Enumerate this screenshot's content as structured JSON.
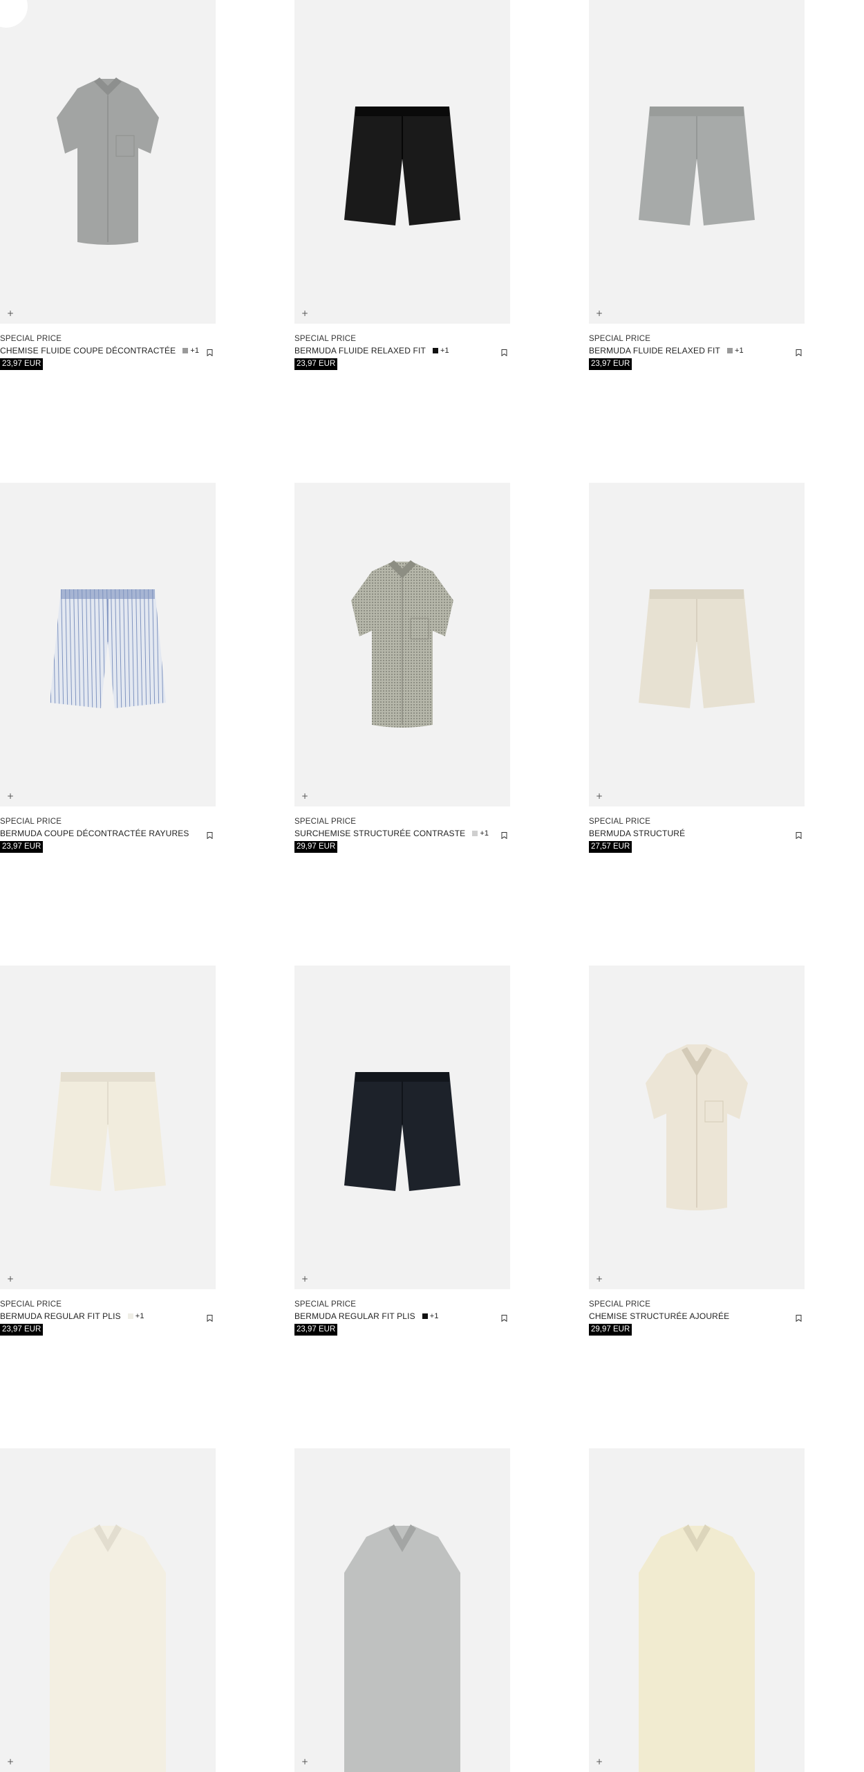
{
  "products": [
    {
      "tag": "SPECIAL PRICE",
      "name": "CHEMISE FLUIDE COUPE DÉCONTRACTÉE",
      "swatch": "#9a9a9a",
      "more": "+1",
      "price": "23,97 EUR",
      "art": "shirt",
      "color": "#a2a4a3",
      "accent": "#8d8f8e"
    },
    {
      "tag": "SPECIAL PRICE",
      "name": "BERMUDA FLUIDE RELAXED FIT",
      "swatch": "#111111",
      "more": "+1",
      "price": "23,97 EUR",
      "art": "shorts",
      "color": "#1a1a1a",
      "accent": "#000000"
    },
    {
      "tag": "SPECIAL PRICE",
      "name": "BERMUDA FLUIDE RELAXED FIT",
      "swatch": "#9a9a9a",
      "more": "+1",
      "price": "23,97 EUR",
      "art": "shorts",
      "color": "#a7aaa9",
      "accent": "#8f9291"
    },
    {
      "tag": "SPECIAL PRICE",
      "name": "BERMUDA COUPE DÉCONTRACTÉE RAYURES",
      "swatch": "",
      "more": "",
      "price": "23,97 EUR",
      "art": "shorts-stripes",
      "color": "#e3e8f1",
      "accent": "#7f93bf"
    },
    {
      "tag": "SPECIAL PRICE",
      "name": "SURCHEMISE STRUCTURÉE CONTRASTE",
      "swatch": "#cfcfcf",
      "more": "+1",
      "price": "29,97 EUR",
      "art": "shirt-texture",
      "color": "#b6b7aa",
      "accent": "#8d8e83"
    },
    {
      "tag": "SPECIAL PRICE",
      "name": "BERMUDA STRUCTURÉ",
      "swatch": "",
      "more": "",
      "price": "27,57 EUR",
      "art": "shorts",
      "color": "#e7e1d2",
      "accent": "#d2cbbb"
    },
    {
      "tag": "SPECIAL PRICE",
      "name": "BERMUDA REGULAR FIT PLIS",
      "swatch": "#efeee6",
      "more": "+1",
      "price": "23,97 EUR",
      "art": "shorts",
      "color": "#f1ecdd",
      "accent": "#dcd6c6"
    },
    {
      "tag": "SPECIAL PRICE",
      "name": "BERMUDA REGULAR FIT PLIS",
      "swatch": "#111111",
      "more": "+1",
      "price": "23,97 EUR",
      "art": "shorts",
      "color": "#1d222a",
      "accent": "#0c0f14"
    },
    {
      "tag": "SPECIAL PRICE",
      "name": "CHEMISE STRUCTURÉE AJOURÉE",
      "swatch": "",
      "more": "",
      "price": "29,97 EUR",
      "art": "shirt-open",
      "color": "#ece5d6",
      "accent": "#d3cab7"
    },
    {
      "tag": "",
      "name": "",
      "swatch": "",
      "more": "",
      "price": "",
      "art": "top-partial",
      "color": "#f3efe2",
      "accent": "#e2ddcf"
    },
    {
      "tag": "",
      "name": "",
      "swatch": "",
      "more": "",
      "price": "",
      "art": "top-partial",
      "color": "#bfc1c0",
      "accent": "#a3a5a4"
    },
    {
      "tag": "",
      "name": "",
      "swatch": "",
      "more": "",
      "price": "",
      "art": "top-partial",
      "color": "#f1ebd0",
      "accent": "#dcd5bb"
    }
  ],
  "icons": {
    "add": "plus-icon",
    "bookmark": "bookmark-icon"
  },
  "labels": {
    "add_symbol": "+"
  }
}
